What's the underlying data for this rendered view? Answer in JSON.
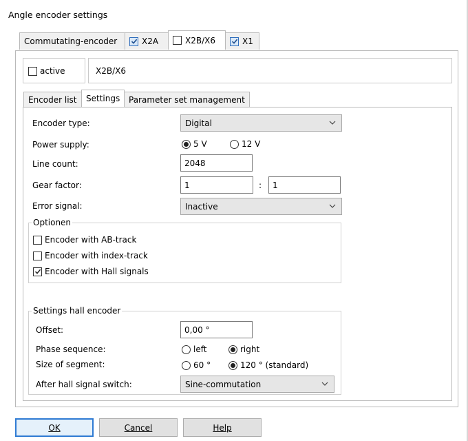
{
  "window": {
    "title": "Angle encoder settings"
  },
  "top_tabs": [
    {
      "label": "Commutating-encoder",
      "checked": null
    },
    {
      "label": "X2A",
      "checked": true
    },
    {
      "label": "X2B/X6",
      "checked": false,
      "selected": true
    },
    {
      "label": "X1",
      "checked": true
    }
  ],
  "active": {
    "label": "active",
    "checked": false
  },
  "channel_name": "X2B/X6",
  "sub_tabs": [
    {
      "label": "Encoder list"
    },
    {
      "label": "Settings",
      "selected": true
    },
    {
      "label": "Parameter set management"
    }
  ],
  "settings": {
    "encoder_type": {
      "label": "Encoder type:",
      "value": "Digital"
    },
    "power_supply": {
      "label": "Power supply:",
      "options": [
        {
          "label": "5 V",
          "selected": true
        },
        {
          "label": "12 V",
          "selected": false
        }
      ]
    },
    "line_count": {
      "label": "Line count:",
      "value": "2048"
    },
    "gear_factor": {
      "label": "Gear factor:",
      "numerator": "1",
      "separator": ":",
      "denominator": "1"
    },
    "error_signal": {
      "label": "Error signal:",
      "value": "Inactive"
    }
  },
  "options_group": {
    "title": "Optionen",
    "items": [
      {
        "label": "Encoder with AB-track",
        "checked": false
      },
      {
        "label": "Encoder with index-track",
        "checked": false
      },
      {
        "label": "Encoder with Hall signals",
        "checked": true
      }
    ]
  },
  "hall_group": {
    "title": "Settings hall encoder",
    "offset": {
      "label": "Offset:",
      "value": "0,00 °"
    },
    "phase_sequence": {
      "label": "Phase sequence:",
      "options": [
        {
          "label": "left",
          "selected": false
        },
        {
          "label": "right",
          "selected": true
        }
      ]
    },
    "segment_size": {
      "label": "Size of segment:",
      "options": [
        {
          "label": "60 °",
          "selected": false
        },
        {
          "label": "120 ° (standard)",
          "selected": true
        }
      ]
    },
    "after_switch": {
      "label": "After hall signal switch:",
      "value": "Sine-commutation"
    }
  },
  "buttons": {
    "ok": "OK",
    "cancel": "Cancel",
    "help": "Help"
  },
  "colors": {
    "default_button_border": "#2f7bd3",
    "checkbox_blue": "#2f6ebd"
  }
}
